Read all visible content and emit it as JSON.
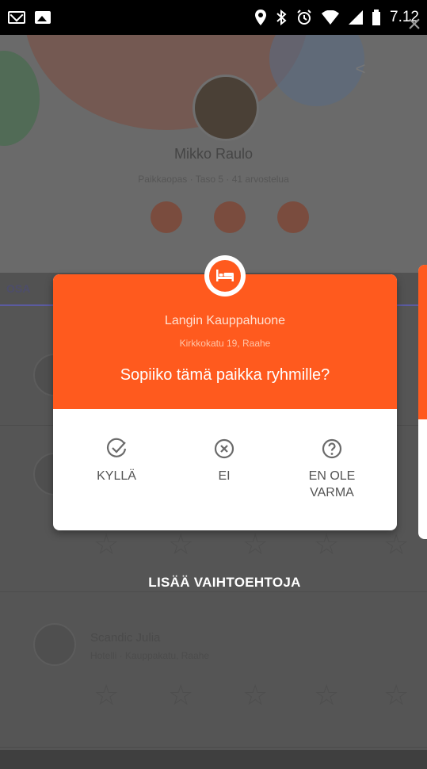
{
  "status_bar": {
    "time": "7.12",
    "left_icons": [
      "mail-icon",
      "image-icon"
    ],
    "right_icons": [
      "location-icon",
      "bluetooth-icon",
      "alarm-icon",
      "wifi-icon",
      "signal-icon",
      "battery-icon"
    ]
  },
  "profile": {
    "name": "Mikko Raulo",
    "subtitle": "Paikkaopas · Taso 5 · 41 arvostelua"
  },
  "tabs": {
    "active": "OSA"
  },
  "list": [
    {
      "title": "",
      "subtitle": ""
    },
    {
      "title": "Scandic Julia",
      "subtitle": "Hotelli · Kauppakatu, Raahe"
    }
  ],
  "card": {
    "place_name": "Langin Kauppahuone",
    "address": "Kirkkokatu 19, Raahe",
    "question": "Sopiiko tämä paikka ryhmille?",
    "answers": {
      "yes": "KYLLÄ",
      "no": "EI",
      "unsure_line1": "EN OLE",
      "unsure_line2": "VARMA"
    },
    "accent_color": "#ff5a1e"
  },
  "more_options": "LISÄÄ VAIHTOEHTOJA"
}
